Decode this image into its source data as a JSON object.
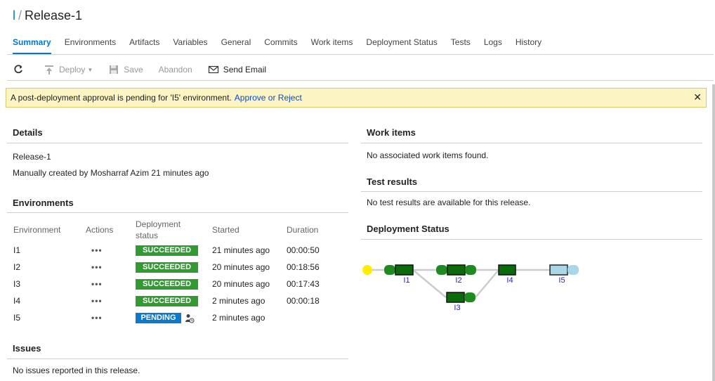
{
  "breadcrumb": {
    "root": "l",
    "separator": "/",
    "title": "Release-1"
  },
  "tabs": [
    {
      "label": "Summary",
      "active": true
    },
    {
      "label": "Environments"
    },
    {
      "label": "Artifacts"
    },
    {
      "label": "Variables"
    },
    {
      "label": "General"
    },
    {
      "label": "Commits"
    },
    {
      "label": "Work items"
    },
    {
      "label": "Deployment Status"
    },
    {
      "label": "Tests"
    },
    {
      "label": "Logs"
    },
    {
      "label": "History"
    }
  ],
  "toolbar": {
    "refresh_icon": "refresh-icon",
    "deploy_label": "Deploy",
    "save_label": "Save",
    "abandon_label": "Abandon",
    "send_email_label": "Send Email"
  },
  "banner": {
    "message": "A post-deployment approval is pending for 'I5' environment.",
    "link": "Approve or Reject",
    "close": "✕",
    "background": "#fcf4c3"
  },
  "details": {
    "title": "Details",
    "release_name": "Release-1",
    "created_text": "Manually created by Mosharraf Azim 21 minutes ago"
  },
  "environments": {
    "title": "Environments",
    "columns": {
      "environment": "Environment",
      "actions": "Actions",
      "deployment_status_1": "Deployment",
      "deployment_status_2": "status",
      "started": "Started",
      "duration": "Duration"
    },
    "rows": [
      {
        "name": "I1",
        "actions": "•••",
        "status": "SUCCEEDED",
        "started": "21 minutes ago",
        "duration": "00:00:50"
      },
      {
        "name": "I2",
        "actions": "•••",
        "status": "SUCCEEDED",
        "started": "20 minutes ago",
        "duration": "00:18:56"
      },
      {
        "name": "I3",
        "actions": "•••",
        "status": "SUCCEEDED",
        "started": "20 minutes ago",
        "duration": "00:17:43"
      },
      {
        "name": "I4",
        "actions": "•••",
        "status": "SUCCEEDED",
        "started": "2 minutes ago",
        "duration": "00:00:18"
      },
      {
        "name": "I5",
        "actions": "•••",
        "status": "PENDING",
        "started": "2 minutes ago",
        "duration": ""
      }
    ],
    "status_colors": {
      "succeeded": "#339933",
      "pending": "#0e79c8"
    }
  },
  "issues": {
    "title": "Issues",
    "empty_text": "No issues reported in this release."
  },
  "work_items": {
    "title": "Work items",
    "empty_text": "No associated work items found."
  },
  "test_results": {
    "title": "Test results",
    "empty_text": "No test results are available for this release."
  },
  "deployment_status": {
    "title": "Deployment Status",
    "nodes": [
      {
        "label": "I1",
        "state": "succeeded"
      },
      {
        "label": "I2",
        "state": "succeeded"
      },
      {
        "label": "I3",
        "state": "succeeded"
      },
      {
        "label": "I4",
        "state": "succeeded"
      },
      {
        "label": "I5",
        "state": "pending"
      }
    ],
    "colors": {
      "succeeded": "#1f8a1f",
      "succeeded_dark": "#0b6b0b",
      "pending": "#aad6e8",
      "start": "#ffee00",
      "edge": "#cccccc",
      "label": "#2222cc"
    }
  }
}
